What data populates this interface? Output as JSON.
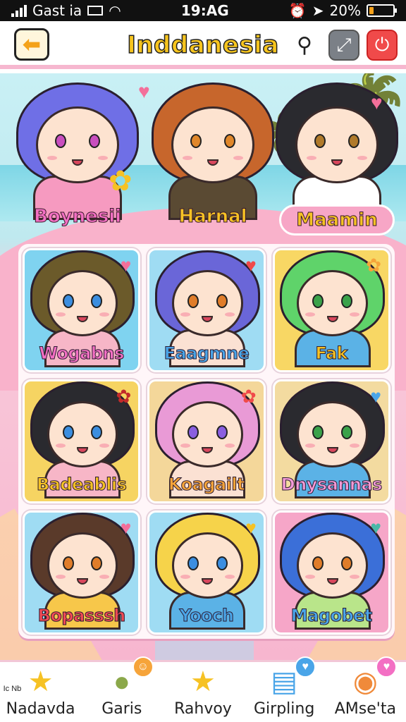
{
  "status_bar": {
    "carrier": "Gast ia",
    "time": "19:AG",
    "battery": "20%",
    "battery_level": 0.2
  },
  "header": {
    "title": "Inddanesia",
    "back_icon": "arrow-left-icon",
    "icons": [
      "search-icon",
      "tools-icon",
      "power-icon"
    ]
  },
  "featured": [
    {
      "label": "Boynesii",
      "label_color": "#f36fc3",
      "hair": "#6f6fe6",
      "shirt": "#f69ac0",
      "eye": "#c94fbf"
    },
    {
      "label": "Harnal",
      "label_color": "#f6c224",
      "hair": "#c7662c",
      "shirt": "#5a4a33",
      "eye": "#e0872a"
    },
    {
      "label": "Maamin",
      "label_color": "#f6c224",
      "hair": "#2a2a2f",
      "shirt": "#ffffff",
      "eye": "#b07a2a"
    }
  ],
  "characters": [
    {
      "label": "Wogabns",
      "label_color": "#f36fc3",
      "bg": "#7fd3f0",
      "hair": "#6b5a2a",
      "shirt": "#f7b6c7",
      "eye": "#3b8ee0"
    },
    {
      "label": "Eaagmne",
      "label_color": "#4aa5e8",
      "bg": "#9fdcf3",
      "hair": "#6a66d8",
      "shirt": "#fbe1d3",
      "eye": "#e07d2a"
    },
    {
      "label": "Fak",
      "label_color": "#f6c224",
      "bg": "#f8d764",
      "hair": "#5fd36a",
      "shirt": "#5bb2e6",
      "eye": "#3aa24a"
    },
    {
      "label": "Badeablis",
      "label_color": "#f6c224",
      "bg": "#f6d462",
      "hair": "#2a2a2f",
      "shirt": "#f7b6c7",
      "eye": "#3b8ee0"
    },
    {
      "label": "Koagailt",
      "label_color": "#f6a43a",
      "bg": "#f4d79a",
      "hair": "#e99ad6",
      "shirt": "#fbe1d3",
      "eye": "#8a5fe0"
    },
    {
      "label": "Dnysannas",
      "label_color": "#f39ad6",
      "bg": "#f3dba0",
      "hair": "#2a2a2f",
      "shirt": "#5bb2e6",
      "eye": "#3aa24a"
    },
    {
      "label": "Bopasssh",
      "label_color": "#f04a55",
      "bg": "#9fdcf3",
      "hair": "#5a3a2a",
      "shirt": "#f7c74a",
      "eye": "#e07d2a"
    },
    {
      "label": "Yooch",
      "label_color": "#4aa5e8",
      "bg": "#9fdcf3",
      "hair": "#f6d34a",
      "shirt": "#5bb2e6",
      "eye": "#3b8ee0"
    },
    {
      "label": "Magobet",
      "label_color": "#4aa5e8",
      "bg": "#f6a6c8",
      "hair": "#3b6fd8",
      "shirt": "#b9e58a",
      "eye": "#e07d2a"
    }
  ],
  "bottom_nav": [
    {
      "label": "Nadavda",
      "icon": "star-icon",
      "sublabel": "Ic Nb"
    },
    {
      "label": "Garis",
      "icon": "friend-icon",
      "badge": "emoji-badge-icon"
    },
    {
      "label": "Rahvoy",
      "icon": "star-icon"
    },
    {
      "label": "Girpling",
      "icon": "store-icon",
      "badge": "heart-badge-icon"
    },
    {
      "label": "AMse'ta",
      "icon": "game-icon",
      "badge": "heart-badge-icon"
    }
  ]
}
